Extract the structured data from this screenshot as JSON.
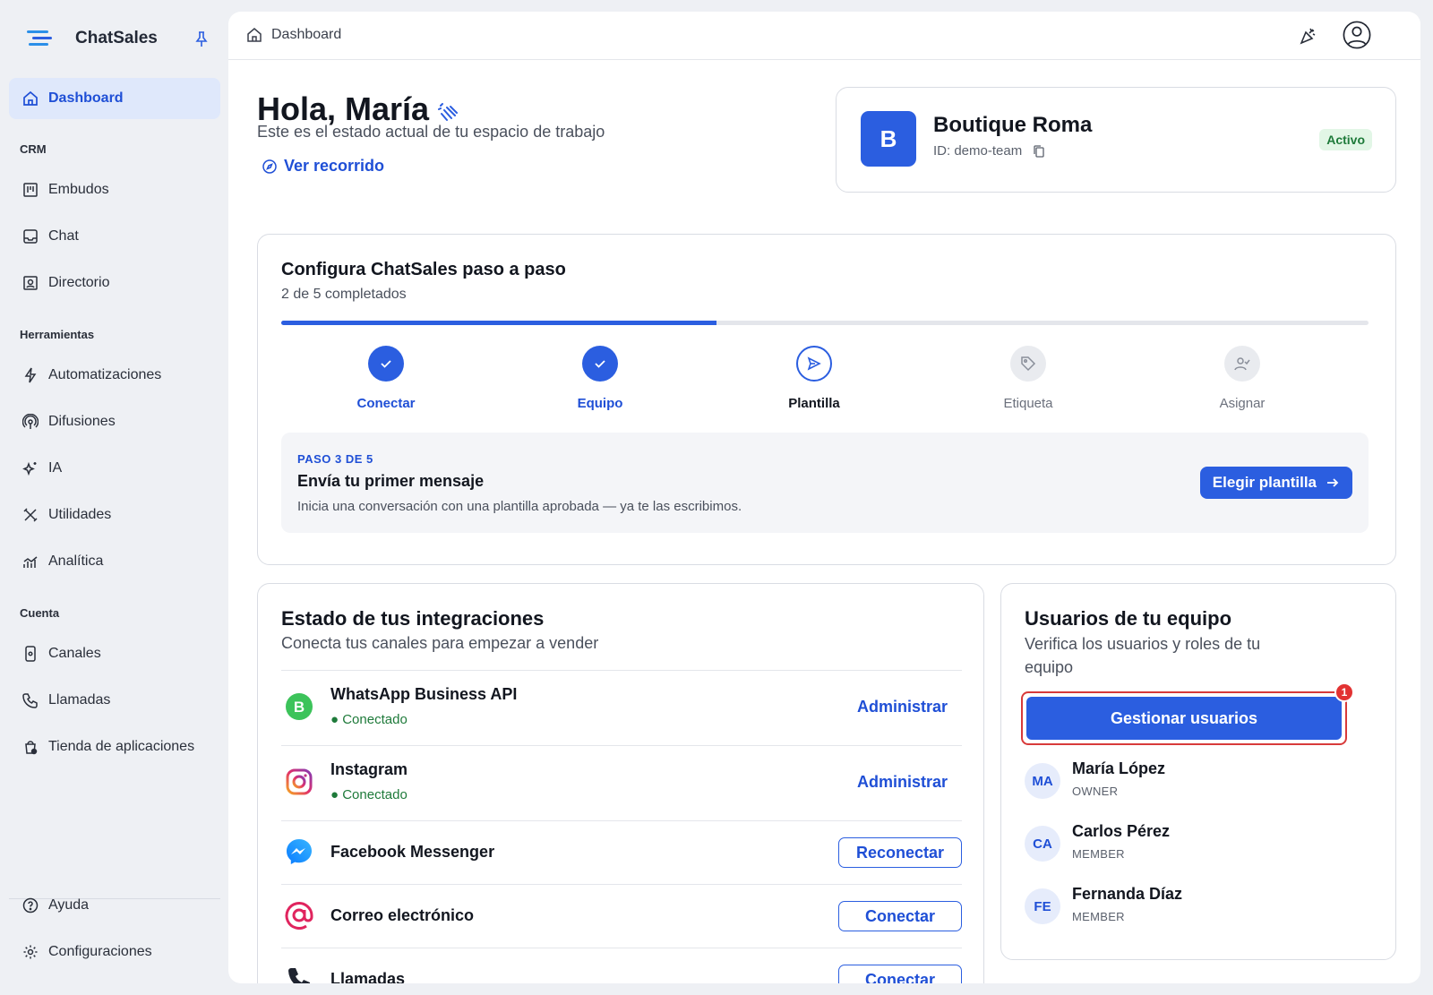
{
  "app": {
    "name": "ChatSales"
  },
  "sidebar": {
    "sections": {
      "crm": "CRM",
      "tools": "Herramientas",
      "account": "Cuenta"
    },
    "items": [
      {
        "label": "Dashboard",
        "icon": "home-icon"
      },
      {
        "label": "Embudos",
        "icon": "kanban-icon"
      },
      {
        "label": "Chat",
        "icon": "inbox-icon"
      },
      {
        "label": "Directorio",
        "icon": "contacts-icon"
      },
      {
        "label": "Automatizaciones",
        "icon": "bolt-icon"
      },
      {
        "label": "Difusiones",
        "icon": "broadcast-icon"
      },
      {
        "label": "IA",
        "icon": "sparkles-icon"
      },
      {
        "label": "Utilidades",
        "icon": "tools-icon"
      },
      {
        "label": "Analítica",
        "icon": "analytics-icon"
      },
      {
        "label": "Canales",
        "icon": "phone-device-icon"
      },
      {
        "label": "Llamadas",
        "icon": "phone-icon"
      },
      {
        "label": "Tienda de aplicaciones",
        "icon": "store-icon"
      }
    ],
    "footer": [
      {
        "label": "Ayuda",
        "icon": "help-icon"
      },
      {
        "label": "Configuraciones",
        "icon": "gear-icon"
      }
    ]
  },
  "topbar": {
    "breadcrumb": "Dashboard"
  },
  "greeting": {
    "title": "Hola, María",
    "subtitle": "Este es el estado actual de tu espacio de trabajo",
    "tour_link": "Ver recorrido"
  },
  "workspace": {
    "initial": "B",
    "name": "Boutique Roma",
    "id": "ID: demo-team",
    "status": "Activo"
  },
  "setup": {
    "title": "Configura ChatSales paso a paso",
    "progress_text": "2 de 5 completados",
    "progress_fraction": 0.4,
    "steps": [
      {
        "label": "Conectar",
        "state": "done"
      },
      {
        "label": "Equipo",
        "state": "done"
      },
      {
        "label": "Plantilla",
        "state": "current"
      },
      {
        "label": "Etiqueta",
        "state": "todo"
      },
      {
        "label": "Asignar",
        "state": "todo"
      }
    ],
    "current": {
      "kicker": "PASO 3 DE 5",
      "title": "Envía tu primer mensaje",
      "description": "Inicia una conversación con una plantilla aprobada — ya te las escribimos.",
      "button": "Elegir plantilla"
    }
  },
  "integrations": {
    "title": "Estado de tus integraciones",
    "subtitle": "Conecta tus canales para empezar a vender",
    "items": [
      {
        "name": "WhatsApp Business API",
        "status": "● Conectado",
        "action": "Administrar",
        "icon": "whatsapp-business-icon"
      },
      {
        "name": "Instagram",
        "status": "● Conectado",
        "action": "Administrar",
        "icon": "instagram-icon"
      },
      {
        "name": "Facebook Messenger",
        "status": "",
        "action": "Reconectar",
        "icon": "messenger-icon"
      },
      {
        "name": "Correo electrónico",
        "status": "",
        "action": "Conectar",
        "icon": "email-at-icon"
      },
      {
        "name": "Llamadas",
        "status": "",
        "action": "Conectar",
        "icon": "phone-icon"
      }
    ]
  },
  "team": {
    "title": "Usuarios de tu equipo",
    "subtitle": "Verifica los usuarios y roles de tu equipo",
    "button": "Gestionar usuarios",
    "badge": "1",
    "members": [
      {
        "initials": "MA",
        "name": "María López",
        "role": "OWNER"
      },
      {
        "initials": "CA",
        "name": "Carlos Pérez",
        "role": "MEMBER"
      },
      {
        "initials": "FE",
        "name": "Fernanda Díaz",
        "role": "MEMBER"
      }
    ]
  },
  "colors": {
    "accent": "#2b5ee0",
    "success": "#1e7a3a",
    "alert": "#e23232"
  }
}
